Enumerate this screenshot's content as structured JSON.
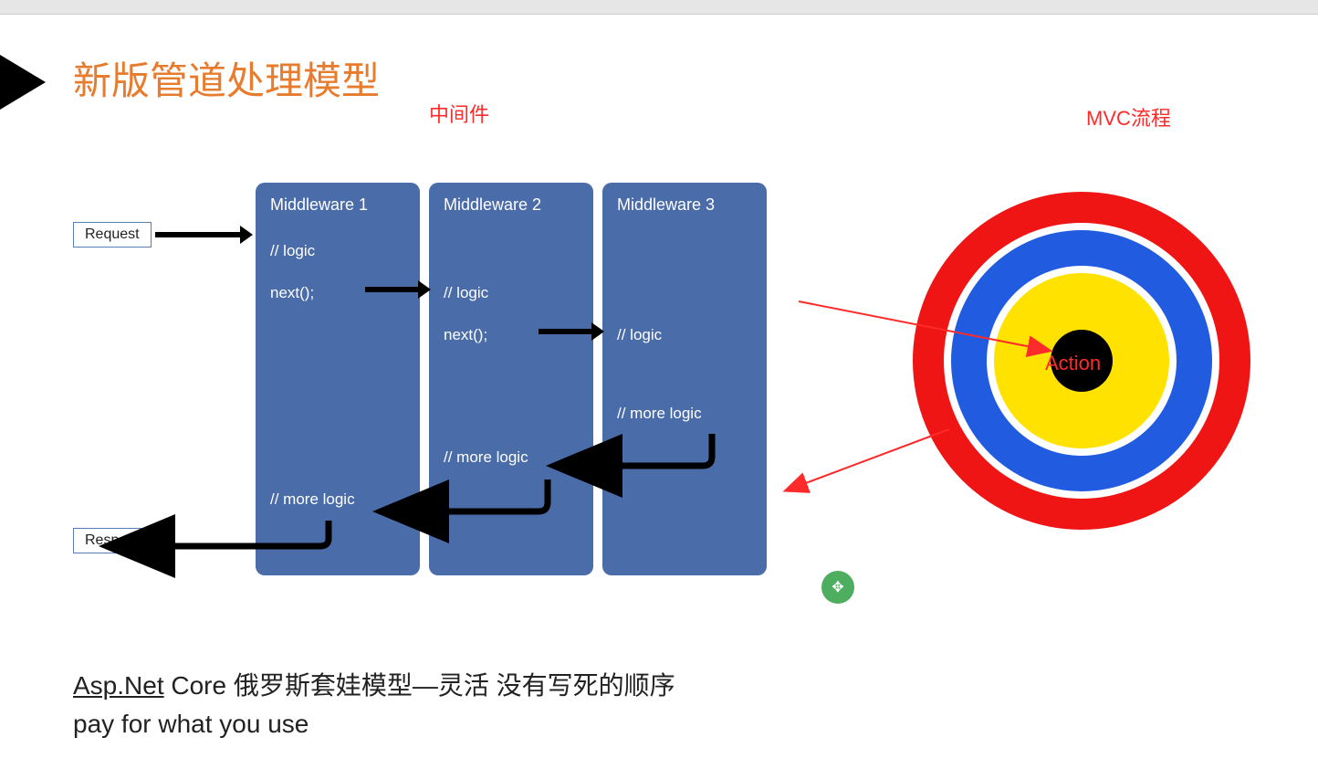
{
  "title": "新版管道处理模型",
  "labels": {
    "middleware": "中间件",
    "mvc": "MVC流程",
    "action": "Action"
  },
  "boxes": {
    "request": "Request",
    "response": "Response"
  },
  "middleware": [
    {
      "title": "Middleware 1",
      "lines": [
        "// logic",
        "next();",
        "",
        "",
        "",
        "",
        "",
        "// more logic"
      ]
    },
    {
      "title": "Middleware 2",
      "lines": [
        "",
        "// logic",
        "next();",
        "",
        "",
        "",
        "// more logic",
        ""
      ]
    },
    {
      "title": "Middleware 3",
      "lines": [
        "",
        "",
        "// logic",
        "",
        "",
        "// more logic",
        "",
        ""
      ]
    }
  ],
  "footer": {
    "line1_underlined": "Asp.Net",
    "line1_rest": " Core 俄罗斯套娃模型—灵活 没有写死的顺序",
    "line2": "pay for what you use"
  },
  "colors": {
    "title": "#e77b2e",
    "red": "#ff2a2a",
    "box": "#4a6ca8",
    "ring_red": "#ef1515",
    "ring_blue": "#215be0",
    "ring_yellow": "#ffe200"
  }
}
